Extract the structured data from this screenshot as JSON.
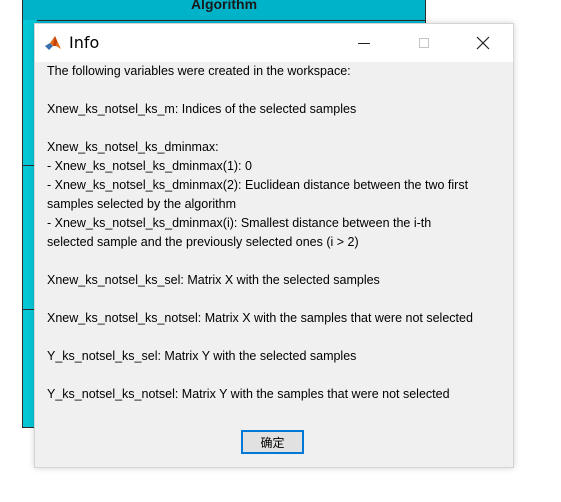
{
  "background_window": {
    "header_title": "Algorithm",
    "color": "#00bcd4"
  },
  "dialog": {
    "title": "Info",
    "app_icon": "matlab-icon",
    "controls": {
      "minimize": "minimize-icon",
      "maximize": "maximize-icon",
      "close": "close-icon"
    },
    "message_lines": [
      "The following variables were created in the workspace:",
      "",
      "Xnew_ks_notsel_ks_m: Indices of the selected samples",
      "",
      "Xnew_ks_notsel_ks_dminmax:",
      "- Xnew_ks_notsel_ks_dminmax(1): 0",
      "- Xnew_ks_notsel_ks_dminmax(2): Euclidean distance between the two first",
      "samples selected by the algorithm",
      "- Xnew_ks_notsel_ks_dminmax(i): Smallest distance between the i-th",
      "selected sample and the previously selected ones (i > 2)",
      "",
      "Xnew_ks_notsel_ks_sel: Matrix X with the selected samples",
      "",
      "Xnew_ks_notsel_ks_notsel: Matrix X with the samples that were not selected",
      "",
      "Y_ks_notsel_ks_sel: Matrix Y with the selected samples",
      "",
      "Y_ks_notsel_ks_notsel: Matrix Y with the samples that were not selected"
    ],
    "ok_label": "确定",
    "accent_color": "#0078d7"
  }
}
